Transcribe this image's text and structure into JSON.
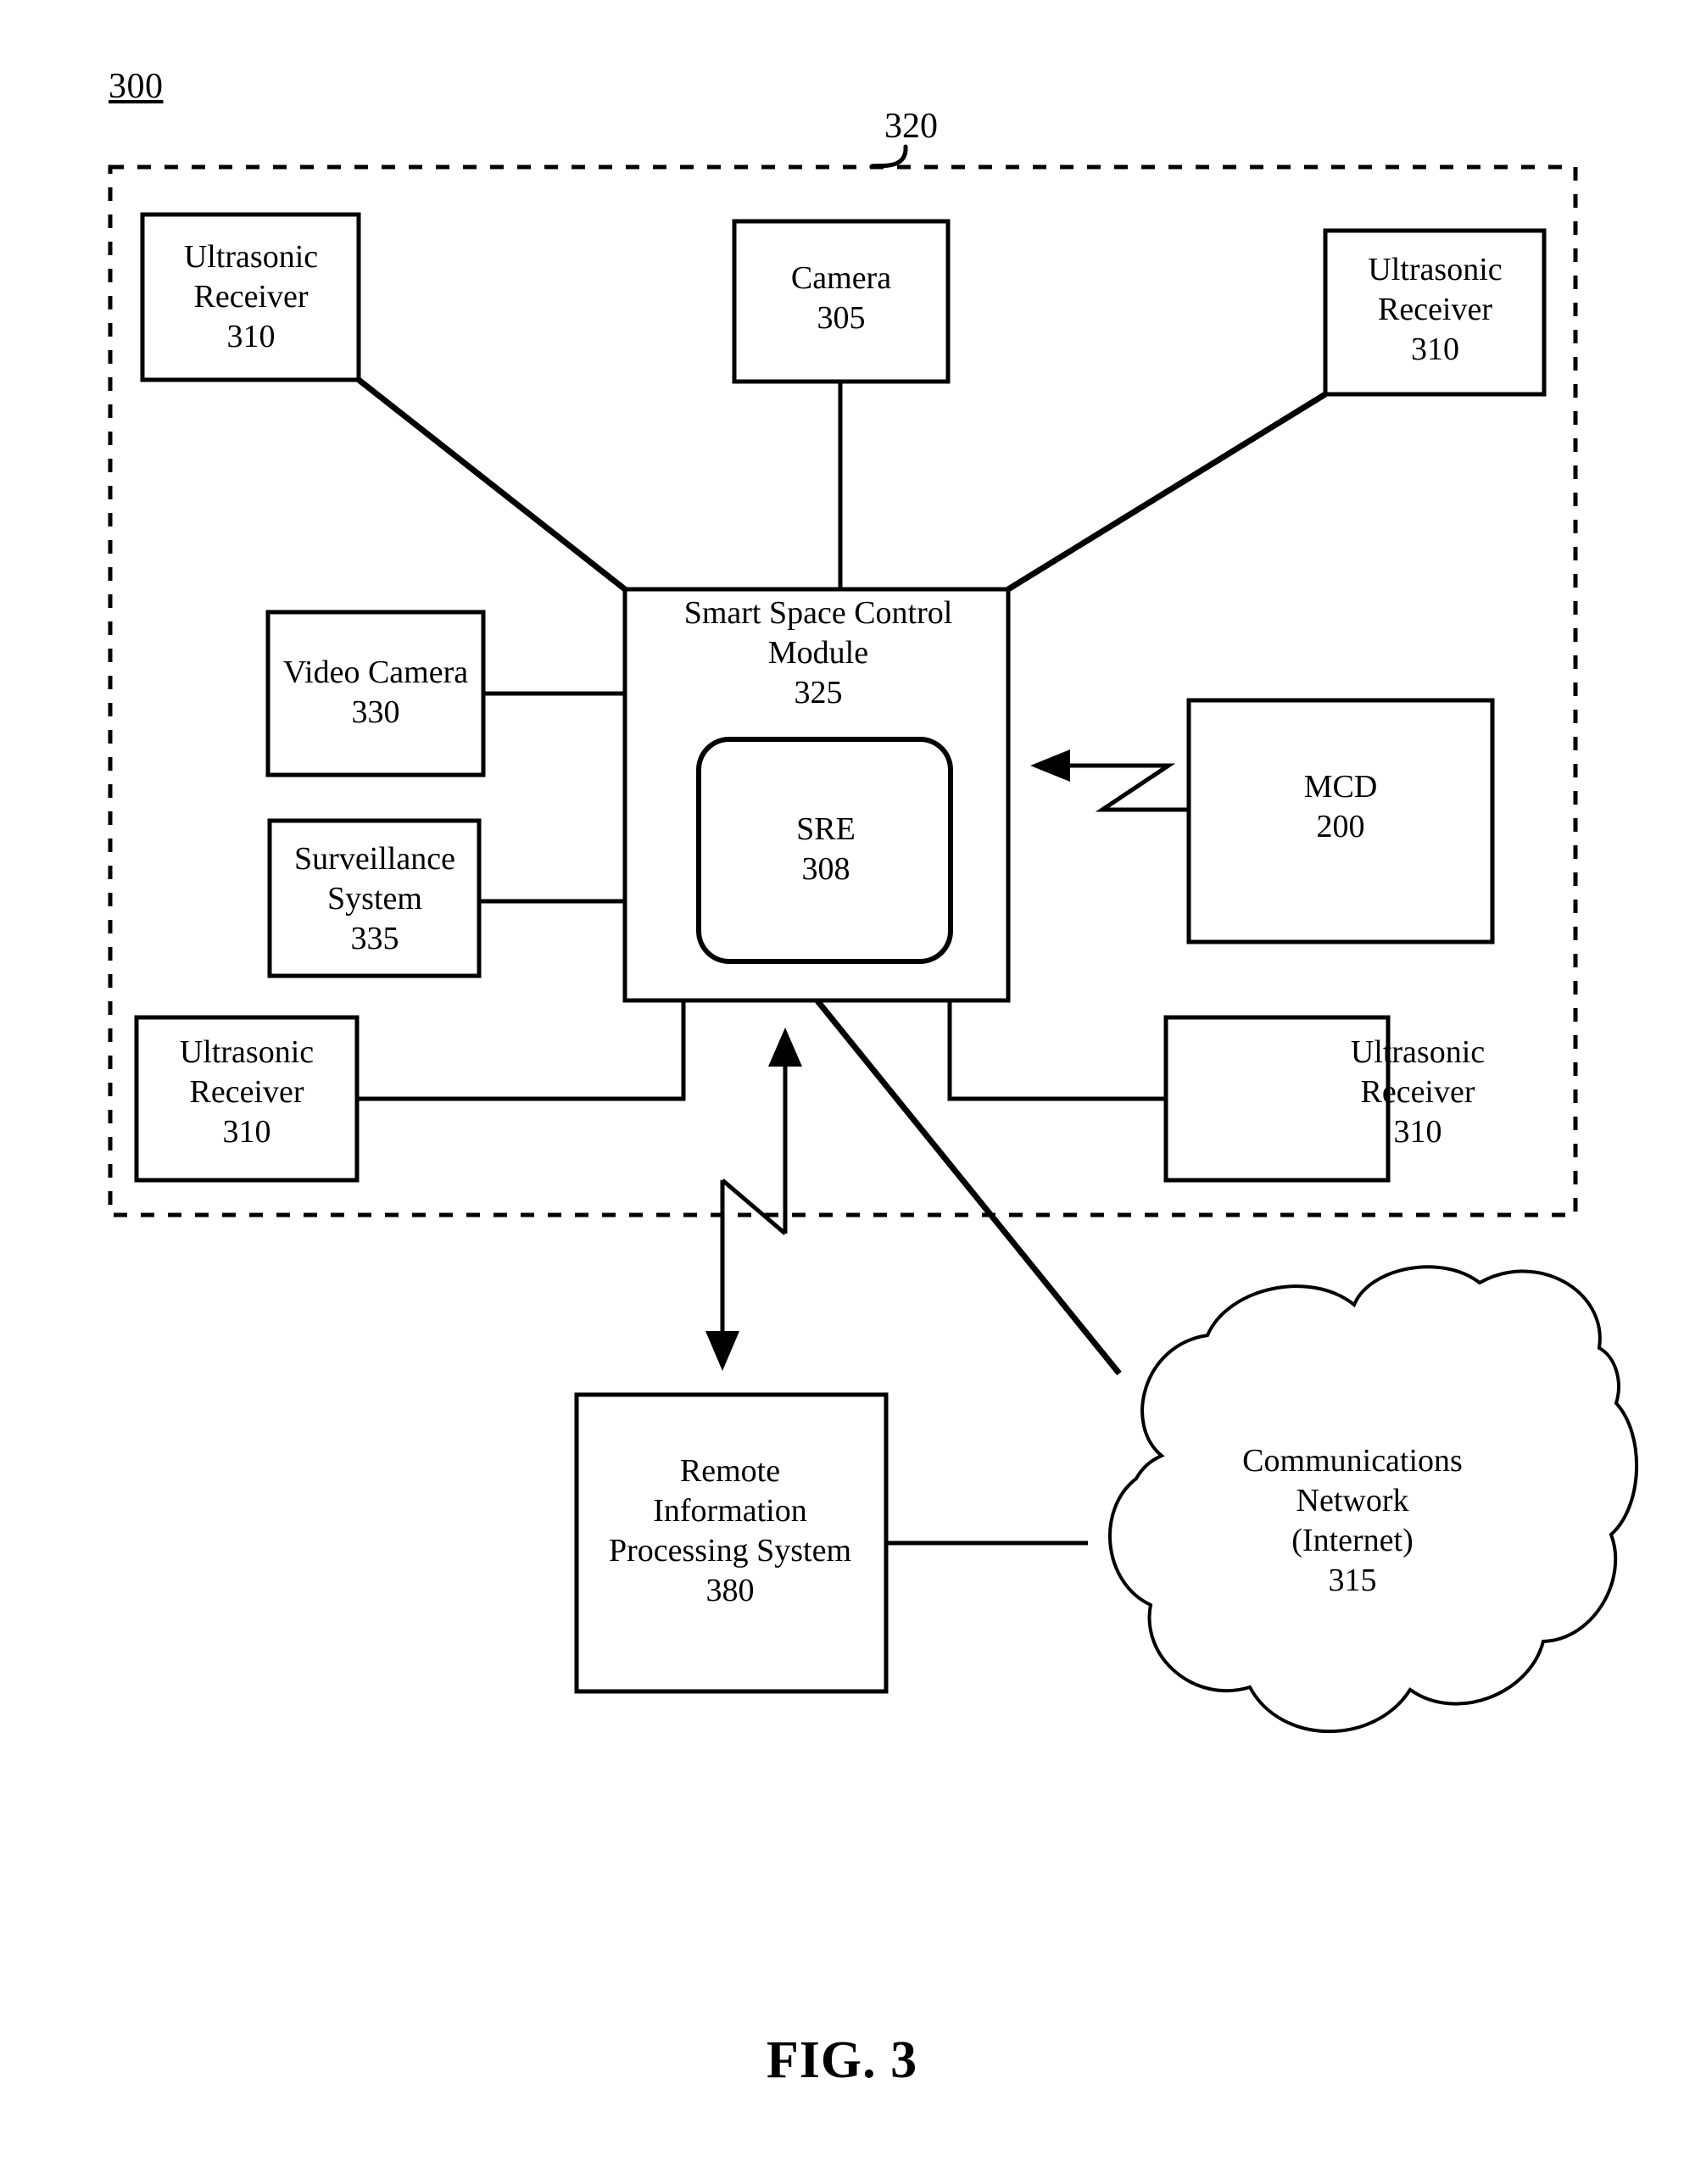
{
  "figure": {
    "system_number": "300",
    "region_number": "320",
    "caption": "FIG. 3"
  },
  "nodes": {
    "ultrasonic_receiver_top_left": {
      "title": "Ultrasonic\nReceiver",
      "ref": "310"
    },
    "camera": {
      "title": "Camera",
      "ref": "305"
    },
    "ultrasonic_receiver_top_right": {
      "title": "Ultrasonic\nReceiver",
      "ref": "310"
    },
    "video_camera": {
      "title": "Video Camera",
      "ref": "330"
    },
    "surveillance_system": {
      "title": "Surveillance\nSystem",
      "ref": "335"
    },
    "ultrasonic_receiver_bottom_left": {
      "title": "Ultrasonic\nReceiver",
      "ref": "310"
    },
    "ultrasonic_receiver_bottom_right": {
      "title": "Ultrasonic\nReceiver",
      "ref": "310"
    },
    "smart_space_control_module": {
      "title": "Smart Space Control\nModule",
      "ref": "325"
    },
    "sre": {
      "title": "SRE",
      "ref": "308"
    },
    "mcd": {
      "title": "MCD",
      "ref": "200"
    },
    "remote_information_processing_system": {
      "title": "Remote\nInformation\nProcessing System",
      "ref": "380"
    },
    "communications_network": {
      "title": "Communications\nNetwork\n(Internet)",
      "ref": "315"
    }
  },
  "labels": {
    "ultrasonic_receiver_top_left": "Ultrasonic\nReceiver\n310",
    "camera": "Camera\n305",
    "ultrasonic_receiver_top_right": "Ultrasonic\nReceiver\n310",
    "video_camera": "Video Camera\n330",
    "surveillance_system": "Surveillance\nSystem\n335",
    "ultrasonic_receiver_bottom_left": "Ultrasonic\nReceiver\n310",
    "ultrasonic_receiver_bottom_right": "Ultrasonic\nReceiver\n310",
    "smart_space_control_module": "Smart Space Control\nModule\n325",
    "sre": "SRE\n308",
    "mcd": "MCD\n200",
    "remote_information_processing_system": "Remote\nInformation\nProcessing System\n380",
    "communications_network": "Communications\nNetwork\n(Internet)\n315"
  },
  "colors": {
    "line": "#000000",
    "background": "#ffffff",
    "text": "#000000"
  },
  "connections": [
    {
      "from": "ultrasonic_receiver_top_left",
      "to": "smart_space_control_module",
      "style": "solid-diagonal"
    },
    {
      "from": "camera",
      "to": "smart_space_control_module",
      "style": "solid-vertical"
    },
    {
      "from": "ultrasonic_receiver_top_right",
      "to": "smart_space_control_module",
      "style": "solid-diagonal"
    },
    {
      "from": "video_camera",
      "to": "smart_space_control_module",
      "style": "solid-horizontal"
    },
    {
      "from": "surveillance_system",
      "to": "smart_space_control_module",
      "style": "solid-horizontal"
    },
    {
      "from": "ultrasonic_receiver_bottom_left",
      "to": "smart_space_control_module",
      "style": "solid-elbow"
    },
    {
      "from": "ultrasonic_receiver_bottom_right",
      "to": "smart_space_control_module",
      "style": "solid-elbow"
    },
    {
      "from": "smart_space_control_module",
      "to": "mcd",
      "style": "wireless-bidirectional"
    },
    {
      "from": "smart_space_control_module",
      "to": "remote_information_processing_system",
      "style": "wireless-bidirectional"
    },
    {
      "from": "smart_space_control_module",
      "to": "communications_network",
      "style": "solid-diagonal"
    },
    {
      "from": "remote_information_processing_system",
      "to": "communications_network",
      "style": "solid-horizontal"
    }
  ]
}
